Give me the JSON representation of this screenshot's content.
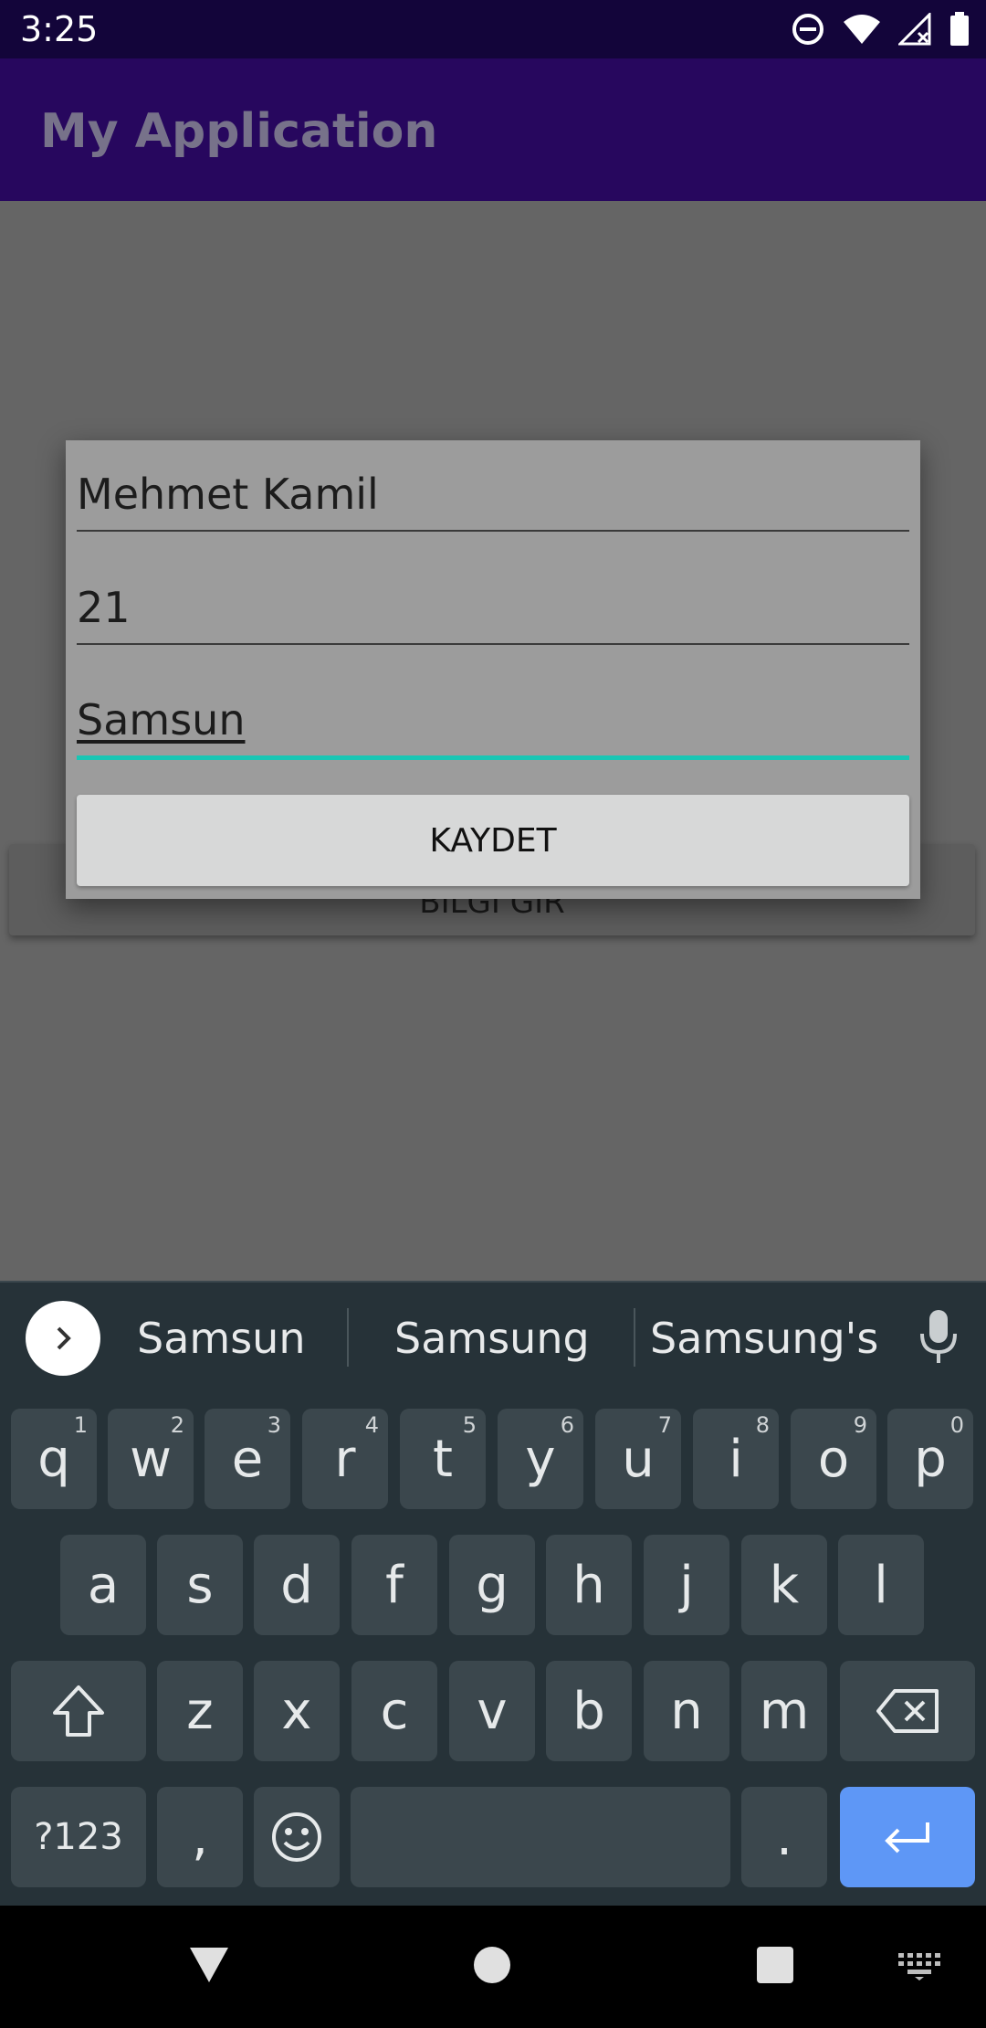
{
  "status_bar": {
    "time": "3:25"
  },
  "app_bar": {
    "title": "My Application"
  },
  "background_button": {
    "label": "BILGI GIR"
  },
  "dialog": {
    "name_value": "Mehmet Kamil",
    "age_value": "21",
    "city_value": "Samsun",
    "save_label": "KAYDET"
  },
  "keyboard": {
    "suggestions": [
      "Samsun",
      "Samsung",
      "Samsung's"
    ],
    "row1": [
      {
        "key": "q",
        "hint": "1"
      },
      {
        "key": "w",
        "hint": "2"
      },
      {
        "key": "e",
        "hint": "3"
      },
      {
        "key": "r",
        "hint": "4"
      },
      {
        "key": "t",
        "hint": "5"
      },
      {
        "key": "y",
        "hint": "6"
      },
      {
        "key": "u",
        "hint": "7"
      },
      {
        "key": "i",
        "hint": "8"
      },
      {
        "key": "o",
        "hint": "9"
      },
      {
        "key": "p",
        "hint": "0"
      }
    ],
    "row2": [
      "a",
      "s",
      "d",
      "f",
      "g",
      "h",
      "j",
      "k",
      "l"
    ],
    "row3": [
      "z",
      "x",
      "c",
      "v",
      "b",
      "n",
      "m"
    ],
    "symbols_label": "?123",
    "comma": ",",
    "period": "."
  },
  "colors": {
    "status_bar": "#13053a",
    "app_bar": "#27075e",
    "accent": "#19c6b4",
    "enter_key": "#5e97f6"
  }
}
